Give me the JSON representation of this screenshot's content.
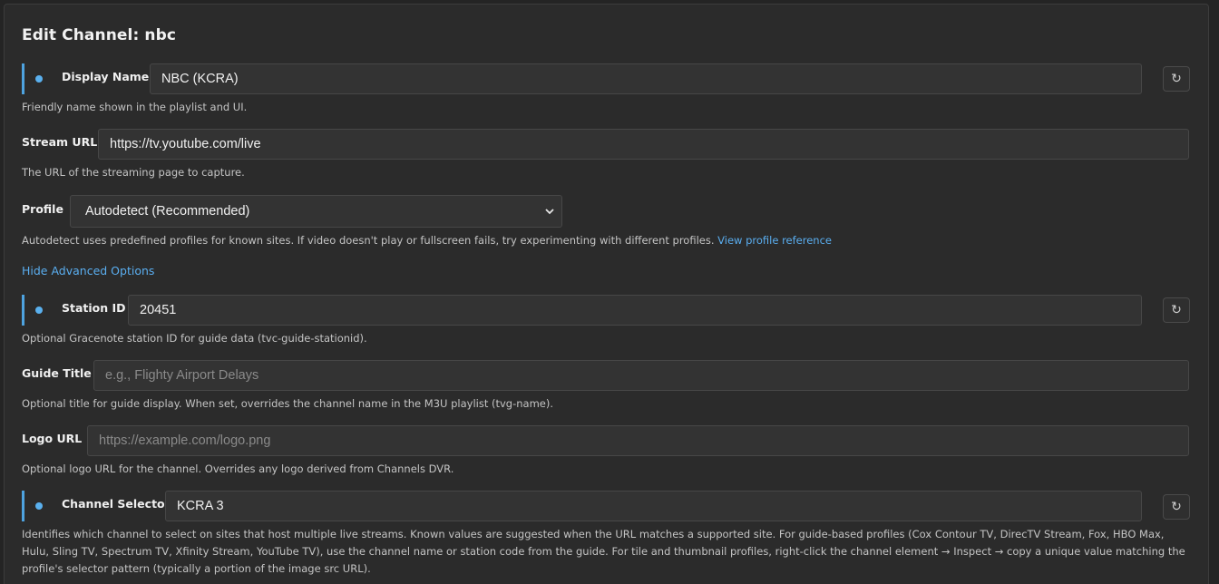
{
  "page_title": "Edit Channel: nbc",
  "fields": {
    "display_name": {
      "label": "Display Name",
      "value": "NBC (KCRA)",
      "help": "Friendly name shown in the playlist and UI."
    },
    "stream_url": {
      "label": "Stream URL",
      "value": "https://tv.youtube.com/live",
      "help": "The URL of the streaming page to capture."
    },
    "profile": {
      "label": "Profile",
      "value": "Autodetect (Recommended)",
      "help": "Autodetect uses predefined profiles for known sites. If video doesn't play or fullscreen fails, try experimenting with different profiles.",
      "help_link": "View profile reference"
    },
    "station_id": {
      "label": "Station ID",
      "value": "20451",
      "help": "Optional Gracenote station ID for guide data (tvc-guide-stationid)."
    },
    "guide_title": {
      "label": "Guide Title",
      "placeholder": "e.g., Flighty Airport Delays",
      "help": "Optional title for guide display. When set, overrides the channel name in the M3U playlist (tvg-name)."
    },
    "logo_url": {
      "label": "Logo URL",
      "placeholder": "https://example.com/logo.png",
      "help": "Optional logo URL for the channel. Overrides any logo derived from Channels DVR."
    },
    "channel_selector": {
      "label": "Channel Selector",
      "value": "KCRA 3",
      "help": "Identifies which channel to select on sites that host multiple live streams. Known values are suggested when the URL matches a supported site. For guide-based profiles (Cox Contour TV, DirecTV Stream, Fox, HBO Max, Hulu, Sling TV, Spectrum TV, Xfinity Stream, YouTube TV), use the channel name or station code from the guide. For tile and thumbnail profiles, right-click the channel element → Inspect → copy a unique value matching the profile's selector pattern (typically a portion of the image src URL)."
    }
  },
  "advanced_toggle": "Hide Advanced Options",
  "icons": {
    "reset": "↻",
    "chevron": "⌄"
  },
  "colors": {
    "accent": "#4ea3e0",
    "link": "#5aaef0",
    "background": "#2b2b2b"
  }
}
